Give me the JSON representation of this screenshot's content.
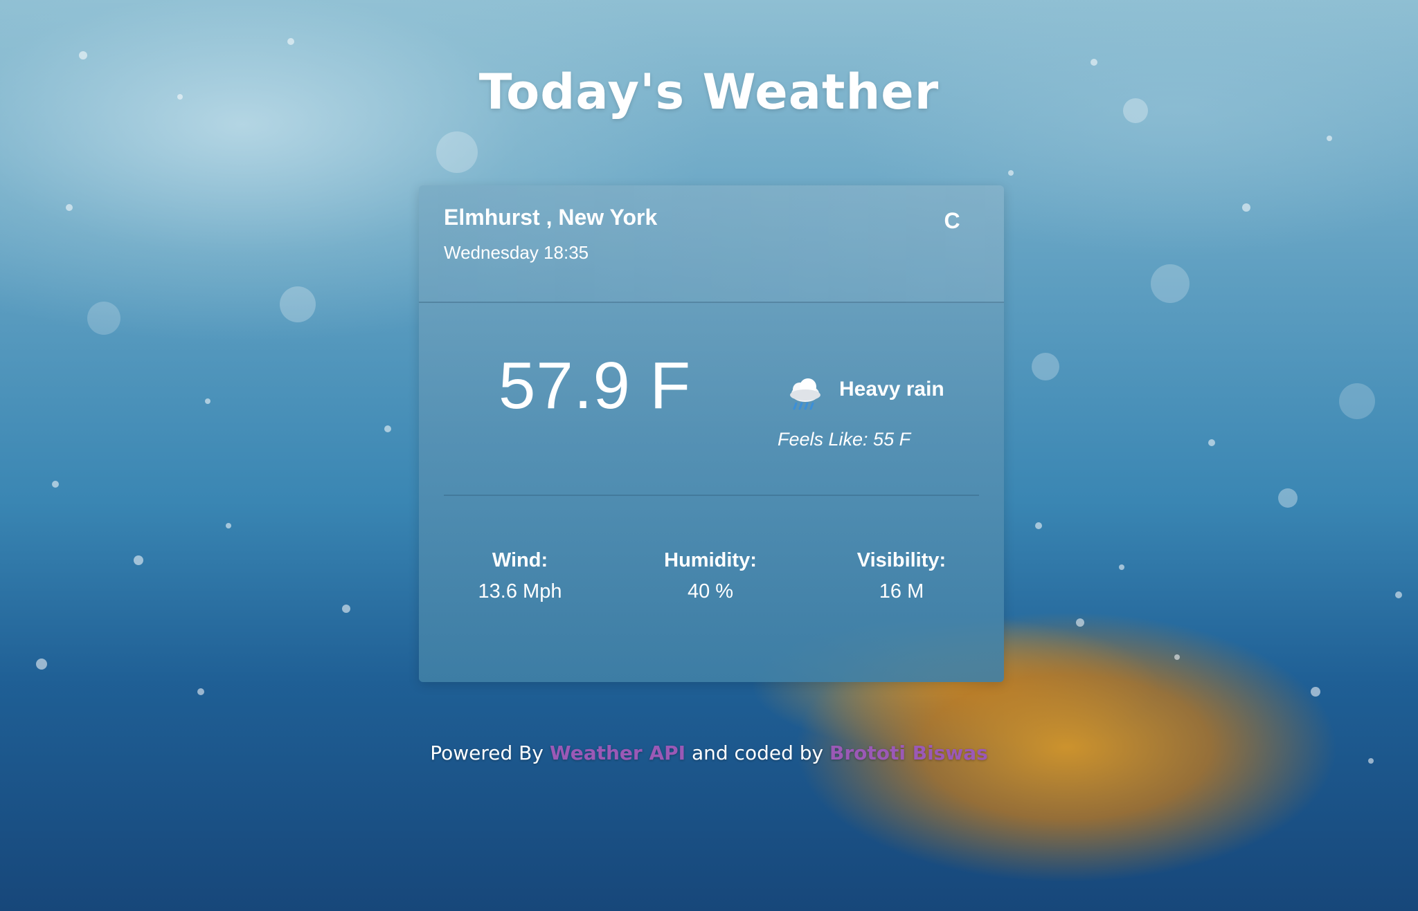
{
  "page": {
    "title": "Today's Weather"
  },
  "location": {
    "name": "Elmhurst , New York",
    "datetime": "Wednesday 18:35",
    "unit_toggle": "C"
  },
  "current": {
    "temperature": "57.9 F",
    "condition": "Heavy rain",
    "condition_icon": "cloud-rain-icon",
    "feels_like": "Feels Like: 55 F"
  },
  "stats": [
    {
      "label": "Wind:",
      "value": "13.6 Mph"
    },
    {
      "label": "Humidity:",
      "value": "40 %"
    },
    {
      "label": "Visibility:",
      "value": "16 M"
    }
  ],
  "footer": {
    "prefix": "Powered By ",
    "api_link": "Weather API",
    "middle": " and coded by ",
    "author_link": "Brototi Biswas"
  },
  "colors": {
    "link": "#9b59b6",
    "text": "#ffffff"
  }
}
